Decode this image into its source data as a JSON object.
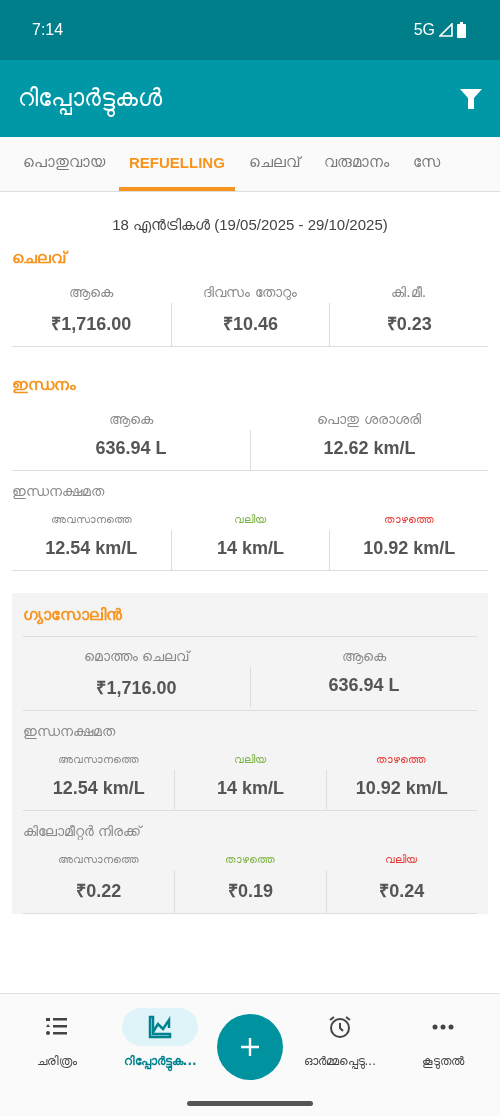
{
  "status_bar": {
    "time": "7:14",
    "network": "5G"
  },
  "app_bar": {
    "title": "റിപ്പോർട്ടുകൾ"
  },
  "tabs": [
    {
      "label": "പൊതുവായ",
      "selected": false
    },
    {
      "label": "REFUELLING",
      "selected": true
    },
    {
      "label": "ചെലവ്",
      "selected": false
    },
    {
      "label": "വരുമാനം",
      "selected": false
    },
    {
      "label": "സേ",
      "selected": false
    }
  ],
  "summary": "18 എൻട്രികൾ (19/05/2025 - 29/10/2025)",
  "sections": [
    {
      "title": "ചെലവ്",
      "shaded": false,
      "groups": [
        {
          "stats": [
            {
              "label": "ആകെ",
              "value": "₹1,716.00",
              "color": "#888888"
            },
            {
              "label": "ദിവസം തോറും",
              "value": "₹10.46",
              "color": "#888888"
            },
            {
              "label": "കി.മീ.",
              "value": "₹0.23",
              "color": "#888888"
            }
          ]
        }
      ]
    },
    {
      "title": "ഇന്ധനം",
      "shaded": false,
      "groups": [
        {
          "stats": [
            {
              "label": "ആകെ",
              "value": "636.94 L",
              "color": "#888888"
            },
            {
              "label": "പൊതു ശരാശരി",
              "value": "12.62 km/L",
              "color": "#888888"
            }
          ]
        },
        {
          "heading": "ഇന്ധനക്ഷമത",
          "stats": [
            {
              "label": "അവസാനത്തെ",
              "value": "12.54 km/L",
              "color": "#888888"
            },
            {
              "label": "വലിയ",
              "value": "14 km/L",
              "color": "#7cb342"
            },
            {
              "label": "താഴത്തെ",
              "value": "10.92 km/L",
              "color": "#e53935"
            }
          ]
        }
      ]
    },
    {
      "title": "ഗ്യാസോലിൻ",
      "shaded": true,
      "groups": [
        {
          "stats": [
            {
              "label": "മൊത്തം ചെലവ്",
              "value": "₹1,716.00",
              "color": "#888888"
            },
            {
              "label": "ആകെ",
              "value": "636.94 L",
              "color": "#888888"
            }
          ]
        },
        {
          "heading": "ഇന്ധനക്ഷമത",
          "stats": [
            {
              "label": "അവസാനത്തെ",
              "value": "12.54 km/L",
              "color": "#888888"
            },
            {
              "label": "വലിയ",
              "value": "14 km/L",
              "color": "#7cb342"
            },
            {
              "label": "താഴത്തെ",
              "value": "10.92 km/L",
              "color": "#e53935"
            }
          ]
        },
        {
          "heading": "കിലോമീറ്റർ നിരക്ക്",
          "stats": [
            {
              "label": "അവസാനത്തെ",
              "value": "₹0.22",
              "color": "#888888"
            },
            {
              "label": "താഴത്തെ",
              "value": "₹0.19",
              "color": "#7cb342"
            },
            {
              "label": "വലിയ",
              "value": "₹0.24",
              "color": "#e53935"
            }
          ]
        }
      ]
    }
  ],
  "bottom_nav": [
    {
      "label": "ചരിത്രം",
      "selected": false
    },
    {
      "label": "റിപ്പോർട്ടുക...",
      "selected": true
    },
    {
      "label": "ഓർമ്മപ്പെടു...",
      "selected": false
    },
    {
      "label": "കൂടുതൽ",
      "selected": false
    }
  ]
}
